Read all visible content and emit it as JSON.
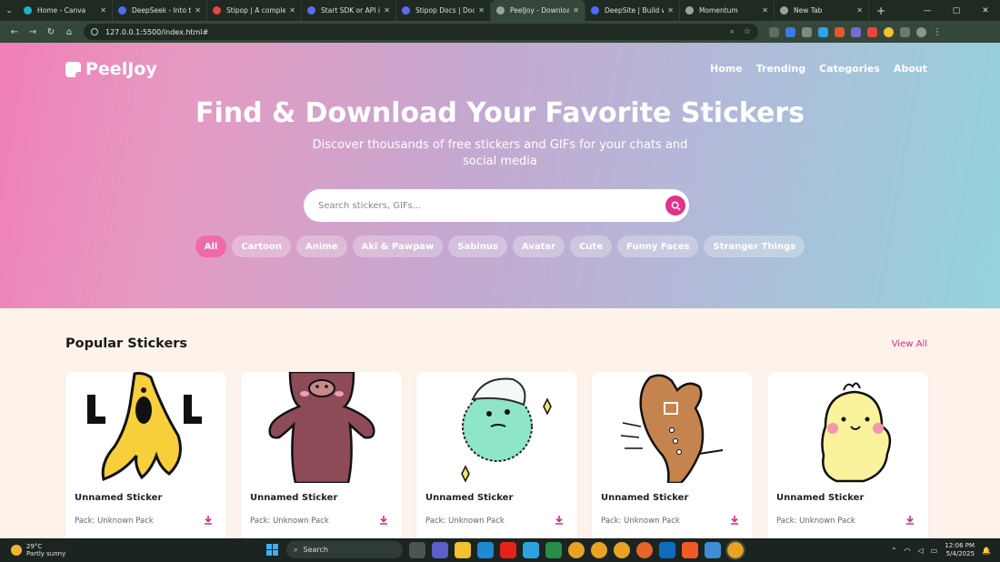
{
  "browser": {
    "tabs": [
      {
        "label": "Home - Canva",
        "color": "#1fb3c8"
      },
      {
        "label": "DeepSeek - Into the Unknown",
        "color": "#4d6bfe"
      },
      {
        "label": "Stipop | A complete s",
        "color": "#e8453c"
      },
      {
        "label": "Start SDK or API integ",
        "color": "#5b6cf2"
      },
      {
        "label": "Stipop Docs | Docum",
        "color": "#5b6cf2"
      },
      {
        "label": "PeelJoy - Download",
        "color": "#9aa59a"
      },
      {
        "label": "DeepSite | Build with",
        "color": "#4d6bfe"
      },
      {
        "label": "Momentum",
        "color": "#9aa59a"
      },
      {
        "label": "New Tab",
        "color": "#9aa59a"
      }
    ],
    "active_tab": 5,
    "url": "127.0.0.1:5500/index.html#"
  },
  "site": {
    "brand": "PeelJoy",
    "nav": [
      "Home",
      "Trending",
      "Categories",
      "About"
    ],
    "hero_title": "Find & Download Your Favorite Stickers",
    "hero_subtitle": "Discover thousands of free stickers and GIFs for your chats and social media",
    "search_placeholder": "Search stickers, GIFs...",
    "categories": [
      "All",
      "Cartoon",
      "Anime",
      "Aki & Pawpaw",
      "Sabinus",
      "Avatar",
      "Cute",
      "Funny Faces",
      "Stranger Things"
    ],
    "active_category": "All",
    "section_title": "Popular Stickers",
    "view_all": "View All",
    "stickers": [
      {
        "name": "Unnamed Sticker",
        "pack": "Pack: Unknown Pack",
        "icon": "banana-lol-sticker"
      },
      {
        "name": "Unnamed Sticker",
        "pack": "Pack: Unknown Pack",
        "icon": "brown-bear-sticker"
      },
      {
        "name": "Unnamed Sticker",
        "pack": "Pack: Unknown Pack",
        "icon": "green-fuzzball-sticker"
      },
      {
        "name": "Unnamed Sticker",
        "pack": "Pack: Unknown Pack",
        "icon": "gingerbread-mitten-sticker"
      },
      {
        "name": "Unnamed Sticker",
        "pack": "Pack: Unknown Pack",
        "icon": "yellow-chick-sticker"
      }
    ],
    "accent_color": "#e0338c"
  },
  "taskbar": {
    "temperature": "29°C",
    "weather": "Partly sunny",
    "search_label": "Search",
    "time": "12:06 PM",
    "date": "5/4/2025"
  }
}
